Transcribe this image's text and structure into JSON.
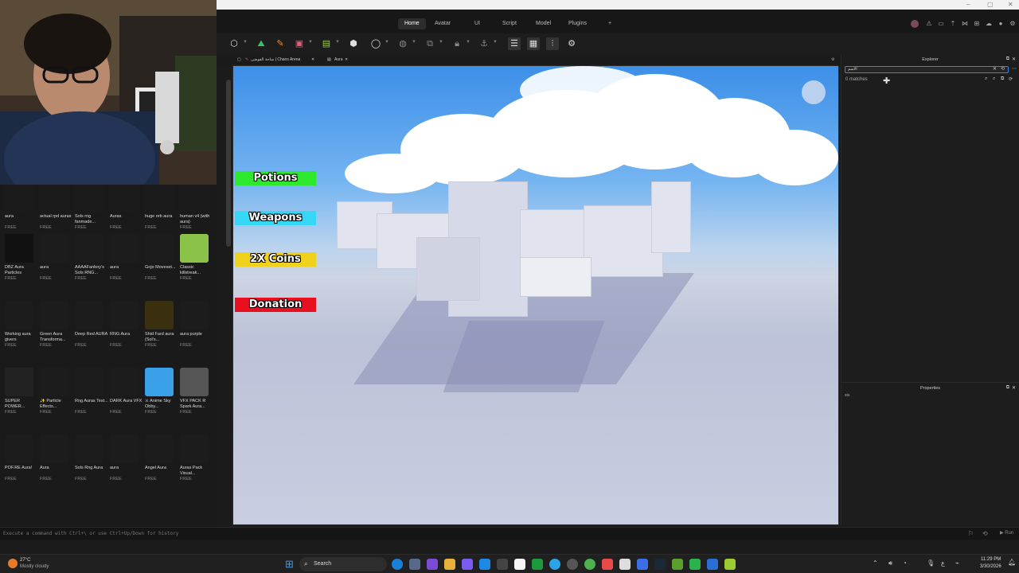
{
  "menubar": {
    "tabs": [
      "Home",
      "Avatar",
      "UI",
      "Script",
      "Model",
      "Plugins"
    ],
    "active": "Home",
    "add_tab": "+"
  },
  "doc_tabs": [
    "ساحة الفوضى | Chaos Arena",
    "Aura"
  ],
  "viewport": {
    "buttons": [
      {
        "label": "Potions",
        "color": "#2ee82e"
      },
      {
        "label": "Weapons",
        "color": "#36d7f4"
      },
      {
        "label": "2X Coins",
        "color": "#f0d21c"
      },
      {
        "label": "Donation",
        "color": "#e8101e"
      }
    ]
  },
  "toolbox": {
    "free_label": "FREE",
    "items": [
      {
        "name": "aura",
        "thumb": "#1b1b1b"
      },
      {
        "name": "actual rpd auras",
        "thumb": "#1b1b1b"
      },
      {
        "name": "Sols rng fanmade...",
        "thumb": "#1b1b1b"
      },
      {
        "name": "Auras",
        "thumb": "#1b1b1b"
      },
      {
        "name": "huge orb aura",
        "thumb": "#1b1b1b"
      },
      {
        "name": "human v4 (with aura)",
        "thumb": "#1b1b1b"
      },
      {
        "name": "DBZ Aura Particles",
        "thumb": "#111111"
      },
      {
        "name": "aura",
        "thumb": "#1c1c1c"
      },
      {
        "name": "AAAAFanboy's Sols RNG...",
        "thumb": "#1c1c1c"
      },
      {
        "name": "aura",
        "thumb": "#1c1c1c"
      },
      {
        "name": "Gojo Moveset...",
        "thumb": "#1c1c1c"
      },
      {
        "name": "Classic killstreak...",
        "thumb": "#8bc34a"
      },
      {
        "name": "Working aura givers",
        "thumb": "#1c1c1c"
      },
      {
        "name": "Green Aura Transforma...",
        "thumb": "#1c1c1c"
      },
      {
        "name": "Deep Red AURA",
        "thumb": "#1c1c1c"
      },
      {
        "name": "RNG Aura",
        "thumb": "#1c1c1c"
      },
      {
        "name": "Shid Fard aura (Sol's...",
        "thumb": "#3a3010"
      },
      {
        "name": "aura purple",
        "thumb": "#1c1c1c"
      },
      {
        "name": "SUPER POWER...",
        "thumb": "#222222"
      },
      {
        "name": "✨ Particle Effects...",
        "thumb": "#1c1c1c"
      },
      {
        "name": "Rng Auras Test...",
        "thumb": "#1c1c1c"
      },
      {
        "name": "DARK Aura VFX",
        "thumb": "#1c1c1c"
      },
      {
        "name": "⚔ Anime Sky Obby...",
        "thumb": "#3aa0e8"
      },
      {
        "name": "VFX PACK R Spark Aura...",
        "thumb": "#555555"
      },
      {
        "name": "POF.RE Aura!",
        "thumb": "#1c1c1c"
      },
      {
        "name": "Aura",
        "thumb": "#1c1c1c"
      },
      {
        "name": "Sols Rng Aura",
        "thumb": "#1c1c1c"
      },
      {
        "name": "aura",
        "thumb": "#1c1c1c"
      },
      {
        "name": "Angel Aura",
        "thumb": "#1c1c1c"
      },
      {
        "name": "Auras Pack Visual...",
        "thumb": "#1c1c1c"
      }
    ]
  },
  "explorer": {
    "title": "Explorer",
    "search_value": "الاسم",
    "matches": "0 matches"
  },
  "properties": {
    "title": "Properties",
    "filter_value": "sts"
  },
  "command_bar": {
    "placeholder": "Execute a command with Ctrl+\\ or use Ctrl+Up/Down for history"
  },
  "taskbar": {
    "weather_temp": "27°C",
    "weather_desc": "Mostly cloudy",
    "search_label": "Search",
    "lang": "ع",
    "time": "11:29 PM",
    "date": "3/30/2026"
  },
  "colors": {
    "accent": "#3d82f0",
    "panel_bg": "#1d1d1d"
  }
}
